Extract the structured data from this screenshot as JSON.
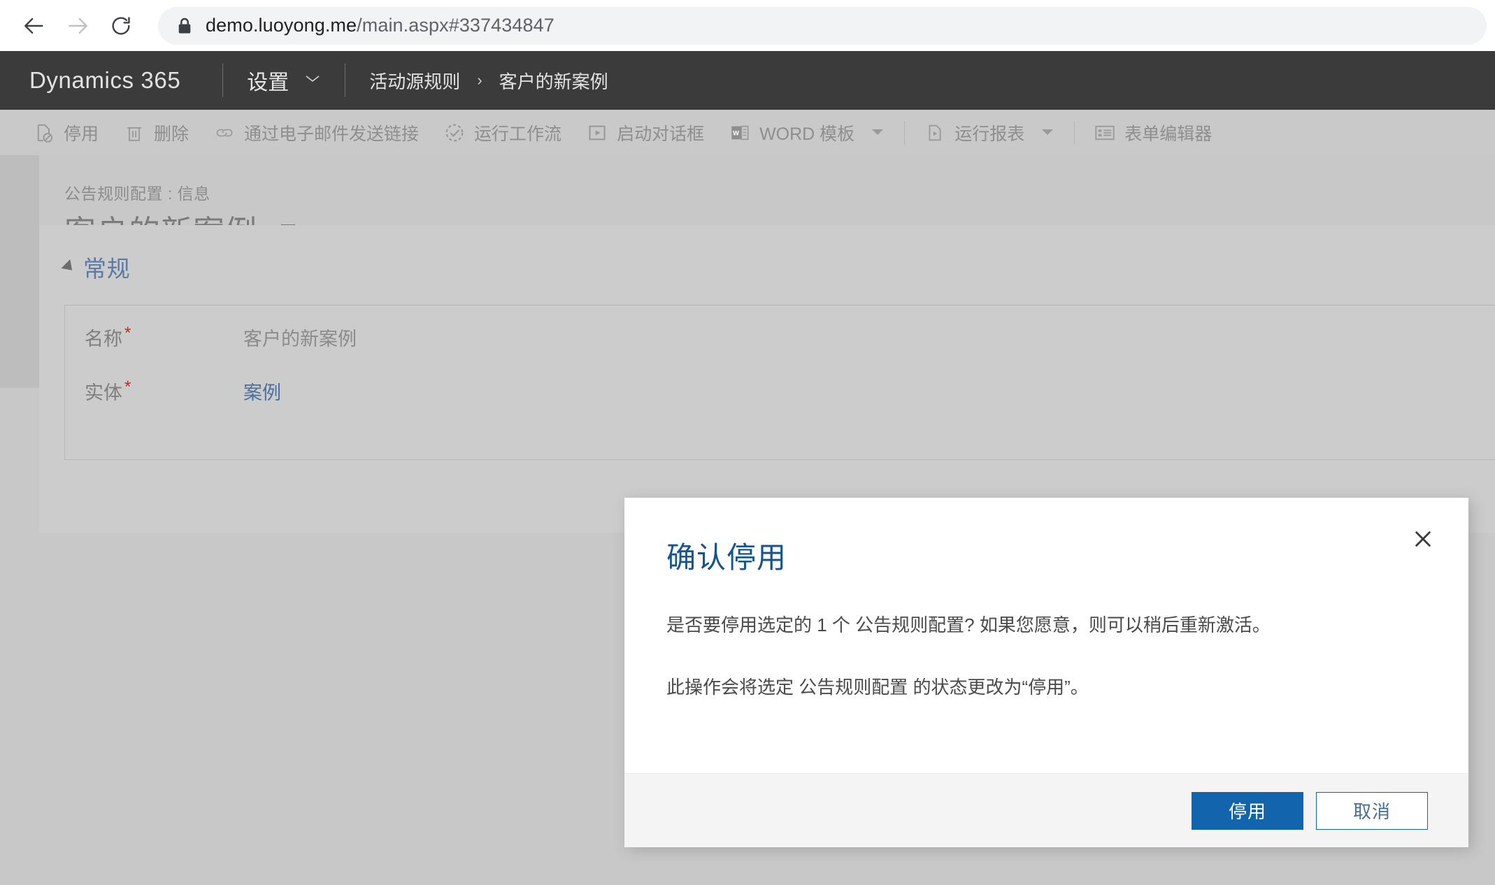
{
  "browser": {
    "back_icon": "arrow-left-icon",
    "forward_icon": "arrow-right-icon",
    "reload_icon": "reload-icon",
    "lock_icon": "lock-icon",
    "url_host": "demo.luoyong.me",
    "url_path": "/main.aspx#337434847"
  },
  "topnav": {
    "logo": "Dynamics 365",
    "area_label": "设置",
    "area_caret_icon": "chevron-down-icon",
    "breadcrumb": [
      {
        "label": "活动源规则"
      },
      {
        "label": "客户的新案例"
      }
    ],
    "crumb_separator": "›"
  },
  "commandbar": {
    "items": [
      {
        "label": "停用",
        "icon": "deactivate-icon",
        "caret": false
      },
      {
        "label": "删除",
        "icon": "trash-icon",
        "caret": false
      },
      {
        "label": "通过电子邮件发送链接",
        "icon": "link-icon",
        "caret": false
      },
      {
        "label": "运行工作流",
        "icon": "workflow-icon",
        "caret": false
      },
      {
        "label": "启动对话框",
        "icon": "dialog-play-icon",
        "caret": false
      },
      {
        "label": "WORD 模板",
        "icon": "word-template-icon",
        "caret": true
      },
      {
        "label": "运行报表",
        "icon": "report-icon",
        "caret": true
      },
      {
        "label": "表单编辑器",
        "icon": "form-editor-icon",
        "caret": false
      }
    ],
    "separator_after_index": 5
  },
  "form": {
    "breadcrumb": "公告规则配置 : 信息",
    "title": "客户的新案例",
    "title_nav_icon": "record-nav-icon",
    "section": {
      "collapse_icon": "triangle-collapse-icon",
      "title": "常规"
    },
    "fields": [
      {
        "label": "名称",
        "required": "*",
        "value": "客户的新案例",
        "is_link": false
      },
      {
        "label": "实体",
        "required": "*",
        "value": "案例",
        "is_link": true
      }
    ]
  },
  "dialog": {
    "title": "确认停用",
    "close_icon": "close-icon",
    "paragraph1": "是否要停用选定的 1 个 公告规则配置? 如果您愿意，则可以稍后重新激活。",
    "paragraph2": "此操作会将选定 公告规则配置 的状态更改为“停用”。",
    "primary_button": "停用",
    "secondary_button": "取消"
  },
  "colors": {
    "accent_blue": "#1264ad",
    "title_blue": "#14558f",
    "nav_dark": "#3b3b3b",
    "required_red": "#b03030",
    "page_gray": "#c8c8c8"
  }
}
